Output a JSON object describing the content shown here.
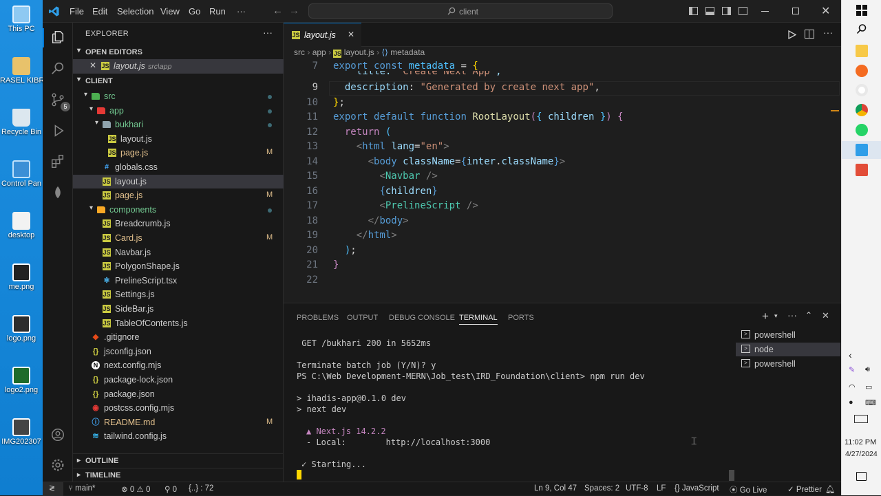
{
  "desktop": {
    "icons": [
      {
        "label": "This PC"
      },
      {
        "label": "RASEL KIBRI"
      },
      {
        "label": "Recycle Bin"
      },
      {
        "label": "Control Pan"
      },
      {
        "label": "desktop"
      },
      {
        "label": "me.png"
      },
      {
        "label": "logo.png"
      },
      {
        "label": "logo2.png"
      },
      {
        "label": "IMG202307"
      }
    ]
  },
  "titlebar": {
    "menu": [
      "File",
      "Edit",
      "Selection",
      "View",
      "Go",
      "Run",
      "···"
    ],
    "search": "client"
  },
  "sidebar": {
    "title": "EXPLORER",
    "open_editors": "OPEN EDITORS",
    "open_file": "layout.js",
    "open_file_path": "src\\app",
    "root": "CLIENT",
    "tree": [
      {
        "label": "src",
        "type": "folder",
        "color": "#73c991",
        "mark": "dot"
      },
      {
        "label": "app",
        "type": "folder",
        "color": "#73c991",
        "mark": "dot"
      },
      {
        "label": "bukhari",
        "type": "folder",
        "color": "#73c991",
        "mark": "dot"
      },
      {
        "label": "layout.js",
        "type": "js",
        "color": "#cccccc",
        "mark": ""
      },
      {
        "label": "page.js",
        "type": "js",
        "color": "#e2c08d",
        "mark": "M"
      },
      {
        "label": "globals.css",
        "type": "css",
        "color": "#cccccc",
        "mark": ""
      },
      {
        "label": "layout.js",
        "type": "js",
        "color": "#cccccc",
        "mark": ""
      },
      {
        "label": "page.js",
        "type": "js",
        "color": "#e2c08d",
        "mark": "M"
      },
      {
        "label": "components",
        "type": "folder",
        "color": "#73c991",
        "mark": "dot"
      },
      {
        "label": "Breadcrumb.js",
        "type": "js",
        "color": "#cccccc",
        "mark": ""
      },
      {
        "label": "Card.js",
        "type": "js",
        "color": "#e2c08d",
        "mark": "M"
      },
      {
        "label": "Navbar.js",
        "type": "js",
        "color": "#cccccc",
        "mark": ""
      },
      {
        "label": "PolygonShape.js",
        "type": "js",
        "color": "#cccccc",
        "mark": ""
      },
      {
        "label": "PrelineScript.tsx",
        "type": "tsx",
        "color": "#cccccc",
        "mark": ""
      },
      {
        "label": "Settings.js",
        "type": "js",
        "color": "#cccccc",
        "mark": ""
      },
      {
        "label": "SideBar.js",
        "type": "js",
        "color": "#cccccc",
        "mark": ""
      },
      {
        "label": "TableOfContents.js",
        "type": "js",
        "color": "#cccccc",
        "mark": ""
      },
      {
        "label": ".gitignore",
        "type": "git",
        "color": "#cccccc",
        "mark": ""
      },
      {
        "label": "jsconfig.json",
        "type": "json",
        "color": "#cccccc",
        "mark": ""
      },
      {
        "label": "next.config.mjs",
        "type": "next",
        "color": "#cccccc",
        "mark": ""
      },
      {
        "label": "package-lock.json",
        "type": "json",
        "color": "#cccccc",
        "mark": ""
      },
      {
        "label": "package.json",
        "type": "json",
        "color": "#cccccc",
        "mark": ""
      },
      {
        "label": "postcss.config.mjs",
        "type": "postcss",
        "color": "#cccccc",
        "mark": ""
      },
      {
        "label": "README.md",
        "type": "md",
        "color": "#e2c08d",
        "mark": "M"
      },
      {
        "label": "tailwind.config.js",
        "type": "tw",
        "color": "#cccccc",
        "mark": ""
      }
    ],
    "outline": "OUTLINE",
    "timeline": "TIMELINE"
  },
  "editor": {
    "tab": "layout.js",
    "breadcrumb": [
      "src",
      "app",
      "layout.js",
      "metadata"
    ],
    "cursor_line": "9"
  },
  "panel": {
    "tabs": [
      "PROBLEMS",
      "OUTPUT",
      "DEBUG CONSOLE",
      "TERMINAL",
      "PORTS"
    ],
    "terminal_lines": [
      "GET /bukhari 200 in 5652ms",
      "Terminate batch job (Y/N)? y",
      "PS C:\\Web Development-MERN\\Job_test\\IRD_Foundation\\client> npm run dev",
      "> ihadis-app@0.1.0 dev",
      "> next dev",
      "▲ Next.js 14.2.2",
      "- Local:        http://localhost:3000",
      "✓ Starting..."
    ],
    "terminals": [
      "powershell",
      "node",
      "powershell"
    ]
  },
  "status": {
    "branch": "main*",
    "errors": "0",
    "warnings": "0",
    "ports": "0",
    "selection": "{..} : 72",
    "position": "Ln 9, Col 47",
    "spaces": "Spaces: 2",
    "encoding": "UTF-8",
    "eol": "LF",
    "language": "JavaScript",
    "golive": "Go Live",
    "prettier": "Prettier"
  },
  "clock": {
    "time": "11:02 PM",
    "date": "4/27/2024"
  }
}
